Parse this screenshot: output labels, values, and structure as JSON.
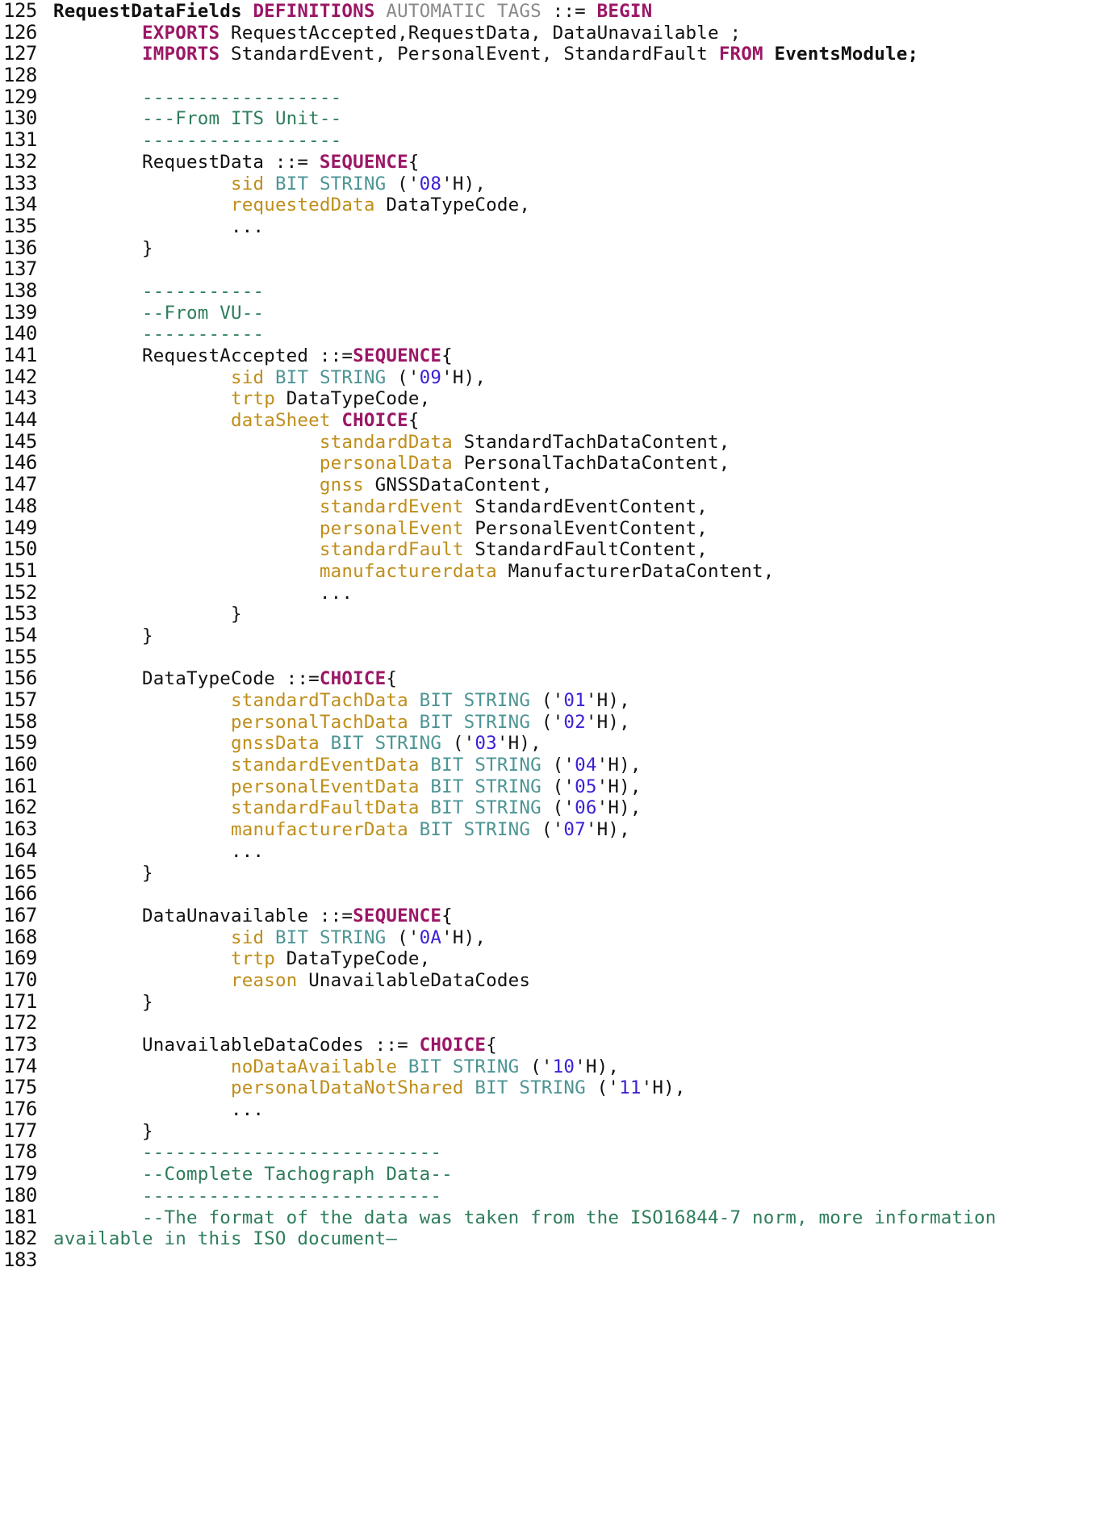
{
  "document": {
    "kind": "source-code-listing",
    "language": "ASN.1",
    "first_line_number": 125,
    "last_line_number": 183,
    "colors": {
      "background": "#ffffff",
      "text": "#111111",
      "line_number": "#111111",
      "comment": "#2e7d5b",
      "keyword": "#9b1766",
      "dim_keyword": "#8a8a8a",
      "field_name": "#bf8e1a",
      "type_name": "#4d9494",
      "hex_literal": "#3a21d6"
    }
  },
  "lines": [
    {
      "n": "125",
      "tokens": [
        {
          "t": "",
          "c": "plain"
        },
        {
          "t": "RequestDataFields ",
          "c": "bold"
        },
        {
          "t": "DEFINITIONS ",
          "c": "keyword"
        },
        {
          "t": "AUTOMATIC TAGS ",
          "c": "dim"
        },
        {
          "t": "::= ",
          "c": "plain"
        },
        {
          "t": "BEGIN",
          "c": "keyword"
        }
      ]
    },
    {
      "n": "126",
      "tokens": [
        {
          "t": "        ",
          "c": "plain"
        },
        {
          "t": "EXPORTS ",
          "c": "keyword"
        },
        {
          "t": "RequestAccepted,RequestData, DataUnavailable ;",
          "c": "plain"
        }
      ]
    },
    {
      "n": "127",
      "tokens": [
        {
          "t": "        ",
          "c": "plain"
        },
        {
          "t": "IMPORTS ",
          "c": "keyword"
        },
        {
          "t": "StandardEvent, PersonalEvent, StandardFault ",
          "c": "plain"
        },
        {
          "t": "FROM ",
          "c": "keyword"
        },
        {
          "t": "EventsModule;",
          "c": "bold"
        }
      ]
    },
    {
      "n": "128",
      "tokens": []
    },
    {
      "n": "129",
      "tokens": [
        {
          "t": "        ",
          "c": "plain"
        },
        {
          "t": "------------------",
          "c": "comment"
        }
      ]
    },
    {
      "n": "130",
      "tokens": [
        {
          "t": "        ",
          "c": "plain"
        },
        {
          "t": "---From ITS Unit--",
          "c": "comment"
        }
      ]
    },
    {
      "n": "131",
      "tokens": [
        {
          "t": "        ",
          "c": "plain"
        },
        {
          "t": "------------------",
          "c": "comment"
        }
      ]
    },
    {
      "n": "132",
      "tokens": [
        {
          "t": "        RequestData ::= ",
          "c": "plain"
        },
        {
          "t": "SEQUENCE",
          "c": "keyword"
        },
        {
          "t": "{",
          "c": "plain"
        }
      ]
    },
    {
      "n": "133",
      "tokens": [
        {
          "t": "                ",
          "c": "plain"
        },
        {
          "t": "sid ",
          "c": "field"
        },
        {
          "t": "BIT STRING ",
          "c": "type"
        },
        {
          "t": "('",
          "c": "plain"
        },
        {
          "t": "08",
          "c": "hex"
        },
        {
          "t": "'H),",
          "c": "plain"
        }
      ]
    },
    {
      "n": "134",
      "tokens": [
        {
          "t": "                ",
          "c": "plain"
        },
        {
          "t": "requestedData ",
          "c": "field"
        },
        {
          "t": "DataTypeCode,",
          "c": "plain"
        }
      ]
    },
    {
      "n": "135",
      "tokens": [
        {
          "t": "                ...",
          "c": "plain"
        }
      ]
    },
    {
      "n": "136",
      "tokens": [
        {
          "t": "        }",
          "c": "plain"
        }
      ]
    },
    {
      "n": "137",
      "tokens": []
    },
    {
      "n": "138",
      "tokens": [
        {
          "t": "        ",
          "c": "plain"
        },
        {
          "t": "-----------",
          "c": "comment"
        }
      ]
    },
    {
      "n": "139",
      "tokens": [
        {
          "t": "        ",
          "c": "plain"
        },
        {
          "t": "--From VU--",
          "c": "comment"
        }
      ]
    },
    {
      "n": "140",
      "tokens": [
        {
          "t": "        ",
          "c": "plain"
        },
        {
          "t": "-----------",
          "c": "comment"
        }
      ]
    },
    {
      "n": "141",
      "tokens": [
        {
          "t": "        RequestAccepted ::=",
          "c": "plain"
        },
        {
          "t": "SEQUENCE",
          "c": "keyword"
        },
        {
          "t": "{",
          "c": "plain"
        }
      ]
    },
    {
      "n": "142",
      "tokens": [
        {
          "t": "                ",
          "c": "plain"
        },
        {
          "t": "sid ",
          "c": "field"
        },
        {
          "t": "BIT STRING ",
          "c": "type"
        },
        {
          "t": "('",
          "c": "plain"
        },
        {
          "t": "09",
          "c": "hex"
        },
        {
          "t": "'H),",
          "c": "plain"
        }
      ]
    },
    {
      "n": "143",
      "tokens": [
        {
          "t": "                ",
          "c": "plain"
        },
        {
          "t": "trtp ",
          "c": "field"
        },
        {
          "t": "DataTypeCode,",
          "c": "plain"
        }
      ]
    },
    {
      "n": "144",
      "tokens": [
        {
          "t": "                ",
          "c": "plain"
        },
        {
          "t": "dataSheet ",
          "c": "field"
        },
        {
          "t": "CHOICE",
          "c": "keyword"
        },
        {
          "t": "{",
          "c": "plain"
        }
      ]
    },
    {
      "n": "145",
      "tokens": [
        {
          "t": "                        ",
          "c": "plain"
        },
        {
          "t": "standardData ",
          "c": "field"
        },
        {
          "t": "StandardTachDataContent,",
          "c": "plain"
        }
      ]
    },
    {
      "n": "146",
      "tokens": [
        {
          "t": "                        ",
          "c": "plain"
        },
        {
          "t": "personalData ",
          "c": "field"
        },
        {
          "t": "PersonalTachDataContent,",
          "c": "plain"
        }
      ]
    },
    {
      "n": "147",
      "tokens": [
        {
          "t": "                        ",
          "c": "plain"
        },
        {
          "t": "gnss ",
          "c": "field"
        },
        {
          "t": "GNSSDataContent,",
          "c": "plain"
        }
      ]
    },
    {
      "n": "148",
      "tokens": [
        {
          "t": "                        ",
          "c": "plain"
        },
        {
          "t": "standardEvent ",
          "c": "field"
        },
        {
          "t": "StandardEventContent,",
          "c": "plain"
        }
      ]
    },
    {
      "n": "149",
      "tokens": [
        {
          "t": "                        ",
          "c": "plain"
        },
        {
          "t": "personalEvent ",
          "c": "field"
        },
        {
          "t": "PersonalEventContent,",
          "c": "plain"
        }
      ]
    },
    {
      "n": "150",
      "tokens": [
        {
          "t": "                        ",
          "c": "plain"
        },
        {
          "t": "standardFault ",
          "c": "field"
        },
        {
          "t": "StandardFaultContent,",
          "c": "plain"
        }
      ]
    },
    {
      "n": "151",
      "tokens": [
        {
          "t": "                        ",
          "c": "plain"
        },
        {
          "t": "manufacturerdata ",
          "c": "field"
        },
        {
          "t": "ManufacturerDataContent,",
          "c": "plain"
        }
      ]
    },
    {
      "n": "152",
      "tokens": [
        {
          "t": "                        ...",
          "c": "plain"
        }
      ]
    },
    {
      "n": "153",
      "tokens": [
        {
          "t": "                }",
          "c": "plain"
        }
      ]
    },
    {
      "n": "154",
      "tokens": [
        {
          "t": "        }",
          "c": "plain"
        }
      ]
    },
    {
      "n": "155",
      "tokens": []
    },
    {
      "n": "156",
      "tokens": [
        {
          "t": "        DataTypeCode ::=",
          "c": "plain"
        },
        {
          "t": "CHOICE",
          "c": "keyword"
        },
        {
          "t": "{",
          "c": "plain"
        }
      ]
    },
    {
      "n": "157",
      "tokens": [
        {
          "t": "                ",
          "c": "plain"
        },
        {
          "t": "standardTachData ",
          "c": "field"
        },
        {
          "t": "BIT STRING ",
          "c": "type"
        },
        {
          "t": "('",
          "c": "plain"
        },
        {
          "t": "01",
          "c": "hex"
        },
        {
          "t": "'H),",
          "c": "plain"
        }
      ]
    },
    {
      "n": "158",
      "tokens": [
        {
          "t": "                ",
          "c": "plain"
        },
        {
          "t": "personalTachData ",
          "c": "field"
        },
        {
          "t": "BIT STRING ",
          "c": "type"
        },
        {
          "t": "('",
          "c": "plain"
        },
        {
          "t": "02",
          "c": "hex"
        },
        {
          "t": "'H),",
          "c": "plain"
        }
      ]
    },
    {
      "n": "159",
      "tokens": [
        {
          "t": "                ",
          "c": "plain"
        },
        {
          "t": "gnssData ",
          "c": "field"
        },
        {
          "t": "BIT STRING ",
          "c": "type"
        },
        {
          "t": "('",
          "c": "plain"
        },
        {
          "t": "03",
          "c": "hex"
        },
        {
          "t": "'H),",
          "c": "plain"
        }
      ]
    },
    {
      "n": "160",
      "tokens": [
        {
          "t": "                ",
          "c": "plain"
        },
        {
          "t": "standardEventData ",
          "c": "field"
        },
        {
          "t": "BIT STRING ",
          "c": "type"
        },
        {
          "t": "('",
          "c": "plain"
        },
        {
          "t": "04",
          "c": "hex"
        },
        {
          "t": "'H),",
          "c": "plain"
        }
      ]
    },
    {
      "n": "161",
      "tokens": [
        {
          "t": "                ",
          "c": "plain"
        },
        {
          "t": "personalEventData ",
          "c": "field"
        },
        {
          "t": "BIT STRING ",
          "c": "type"
        },
        {
          "t": "('",
          "c": "plain"
        },
        {
          "t": "05",
          "c": "hex"
        },
        {
          "t": "'H),",
          "c": "plain"
        }
      ]
    },
    {
      "n": "162",
      "tokens": [
        {
          "t": "                ",
          "c": "plain"
        },
        {
          "t": "standardFaultData ",
          "c": "field"
        },
        {
          "t": "BIT STRING ",
          "c": "type"
        },
        {
          "t": "('",
          "c": "plain"
        },
        {
          "t": "06",
          "c": "hex"
        },
        {
          "t": "'H),",
          "c": "plain"
        }
      ]
    },
    {
      "n": "163",
      "tokens": [
        {
          "t": "                ",
          "c": "plain"
        },
        {
          "t": "manufacturerData ",
          "c": "field"
        },
        {
          "t": "BIT STRING ",
          "c": "type"
        },
        {
          "t": "('",
          "c": "plain"
        },
        {
          "t": "07",
          "c": "hex"
        },
        {
          "t": "'H),",
          "c": "plain"
        }
      ]
    },
    {
      "n": "164",
      "tokens": [
        {
          "t": "                ...",
          "c": "plain"
        }
      ]
    },
    {
      "n": "165",
      "tokens": [
        {
          "t": "        }",
          "c": "plain"
        }
      ]
    },
    {
      "n": "166",
      "tokens": []
    },
    {
      "n": "167",
      "tokens": [
        {
          "t": "        DataUnavailable ::=",
          "c": "plain"
        },
        {
          "t": "SEQUENCE",
          "c": "keyword"
        },
        {
          "t": "{",
          "c": "plain"
        }
      ]
    },
    {
      "n": "168",
      "tokens": [
        {
          "t": "                ",
          "c": "plain"
        },
        {
          "t": "sid ",
          "c": "field"
        },
        {
          "t": "BIT STRING ",
          "c": "type"
        },
        {
          "t": "('",
          "c": "plain"
        },
        {
          "t": "0A",
          "c": "hex"
        },
        {
          "t": "'H),",
          "c": "plain"
        }
      ]
    },
    {
      "n": "169",
      "tokens": [
        {
          "t": "                ",
          "c": "plain"
        },
        {
          "t": "trtp ",
          "c": "field"
        },
        {
          "t": "DataTypeCode,",
          "c": "plain"
        }
      ]
    },
    {
      "n": "170",
      "tokens": [
        {
          "t": "                ",
          "c": "plain"
        },
        {
          "t": "reason ",
          "c": "field"
        },
        {
          "t": "UnavailableDataCodes",
          "c": "plain"
        }
      ]
    },
    {
      "n": "171",
      "tokens": [
        {
          "t": "        }",
          "c": "plain"
        }
      ]
    },
    {
      "n": "172",
      "tokens": []
    },
    {
      "n": "173",
      "tokens": [
        {
          "t": "        UnavailableDataCodes ::= ",
          "c": "plain"
        },
        {
          "t": "CHOICE",
          "c": "keyword"
        },
        {
          "t": "{",
          "c": "plain"
        }
      ]
    },
    {
      "n": "174",
      "tokens": [
        {
          "t": "                ",
          "c": "plain"
        },
        {
          "t": "noDataAvailable ",
          "c": "field"
        },
        {
          "t": "BIT STRING ",
          "c": "type"
        },
        {
          "t": "('",
          "c": "plain"
        },
        {
          "t": "10",
          "c": "hex"
        },
        {
          "t": "'H),",
          "c": "plain"
        }
      ]
    },
    {
      "n": "175",
      "tokens": [
        {
          "t": "                ",
          "c": "plain"
        },
        {
          "t": "personalDataNotShared ",
          "c": "field"
        },
        {
          "t": "BIT STRING ",
          "c": "type"
        },
        {
          "t": "('",
          "c": "plain"
        },
        {
          "t": "11",
          "c": "hex"
        },
        {
          "t": "'H),",
          "c": "plain"
        }
      ]
    },
    {
      "n": "176",
      "tokens": [
        {
          "t": "                ...",
          "c": "plain"
        }
      ]
    },
    {
      "n": "177",
      "tokens": [
        {
          "t": "        }",
          "c": "plain"
        }
      ]
    },
    {
      "n": "178",
      "tokens": [
        {
          "t": "        ",
          "c": "plain"
        },
        {
          "t": "---------------------------",
          "c": "comment"
        }
      ]
    },
    {
      "n": "179",
      "tokens": [
        {
          "t": "        ",
          "c": "plain"
        },
        {
          "t": "--Complete Tachograph Data--",
          "c": "comment"
        }
      ]
    },
    {
      "n": "180",
      "tokens": [
        {
          "t": "        ",
          "c": "plain"
        },
        {
          "t": "---------------------------",
          "c": "comment"
        }
      ]
    },
    {
      "n": "181",
      "tokens": [
        {
          "t": "        ",
          "c": "plain"
        },
        {
          "t": "--The format of the data was taken from the ISO16844-7 norm, more information",
          "c": "comment"
        }
      ]
    },
    {
      "n": "182",
      "tokens": [
        {
          "t": "available in this ISO document–",
          "c": "comment"
        }
      ]
    },
    {
      "n": "183",
      "tokens": []
    }
  ]
}
